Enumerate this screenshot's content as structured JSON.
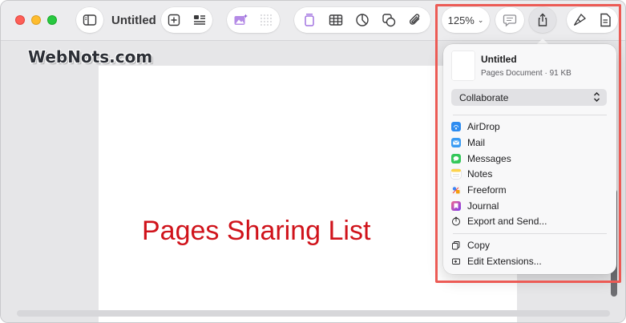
{
  "window": {
    "title": "Untitled"
  },
  "toolbar": {
    "zoom_label": "125%",
    "icons": [
      "sidebar-icon",
      "add-page-icon",
      "format-text-icon",
      "media-icon",
      "grid-icon",
      "text-box-icon",
      "table-icon",
      "chart-icon",
      "shape-icon",
      "attachment-icon",
      "comment-icon",
      "share-icon",
      "format-brush-icon",
      "document-icon"
    ]
  },
  "share_popover": {
    "doc_name": "Untitled",
    "doc_meta": "Pages Document · 91 KB",
    "collaborate_label": "Collaborate",
    "items": [
      {
        "label": "AirDrop",
        "icon": "airdrop-icon",
        "color": "#2e8cf0"
      },
      {
        "label": "Mail",
        "icon": "mail-icon",
        "color": "#3a9bf3"
      },
      {
        "label": "Messages",
        "icon": "messages-icon",
        "color": "#34c759"
      },
      {
        "label": "Notes",
        "icon": "notes-icon",
        "color": "#fcd34d"
      },
      {
        "label": "Freeform",
        "icon": "freeform-icon",
        "color": "#f5f5f5"
      },
      {
        "label": "Journal",
        "icon": "journal-icon",
        "color": "#7c3aed"
      },
      {
        "label": "Export and Send...",
        "icon": "export-icon",
        "color": "#ffffff"
      }
    ],
    "extra_items": [
      {
        "label": "Copy",
        "icon": "copy-icon"
      },
      {
        "label": "Edit Extensions...",
        "icon": "extensions-icon"
      }
    ]
  },
  "overlay": {
    "watermark": "WebNots.com",
    "caption": "Pages Sharing List",
    "caption_color": "#d0131b",
    "highlight_color": "#ec5b55"
  }
}
